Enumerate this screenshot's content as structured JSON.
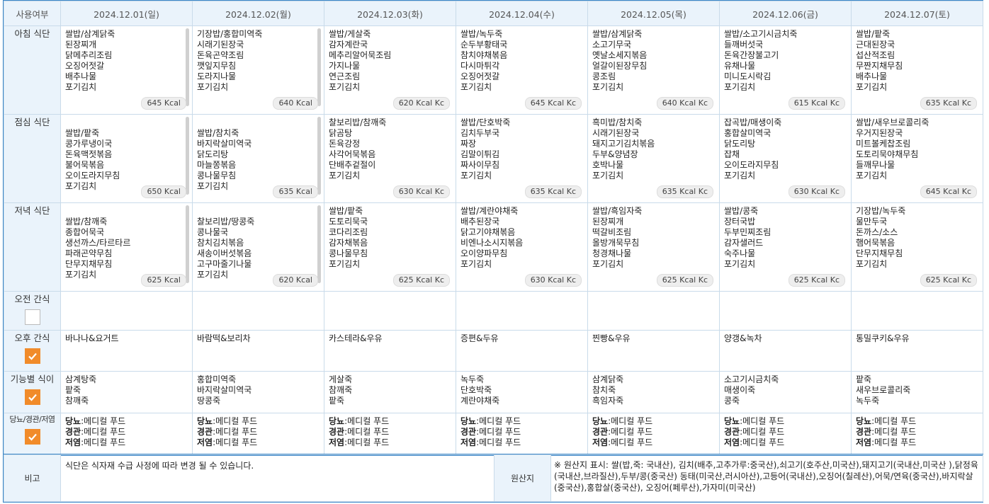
{
  "header": {
    "first_col": "사용여부",
    "dates": [
      {
        "label": "2024.12.01(일)",
        "kind": "sun"
      },
      {
        "label": "2024.12.02(월)",
        "kind": "normal"
      },
      {
        "label": "2024.12.03(화)",
        "kind": "normal"
      },
      {
        "label": "2024.12.04(수)",
        "kind": "normal"
      },
      {
        "label": "2024.12.05(목)",
        "kind": "normal"
      },
      {
        "label": "2024.12.06(금)",
        "kind": "normal"
      },
      {
        "label": "2024.12.07(토)",
        "kind": "sat"
      }
    ]
  },
  "rows": {
    "breakfast": {
      "label": "아침 식단",
      "days": [
        {
          "items": [
            "쌀밥/삼계닭죽",
            "된장찌개",
            "닭메추리조림",
            "오징어젓갈",
            "배추나물",
            "포기김치"
          ],
          "kcal": "645 Kcal",
          "scroll": true
        },
        {
          "items": [
            "기장밥/홍합미역죽",
            "시래기된장국",
            "돈육곤약조림",
            "깻잎지무침",
            "도라지나물",
            "포기김치"
          ],
          "kcal": "640 Kcal",
          "scroll": true
        },
        {
          "items": [
            "쌀밥/게살죽",
            "감자계란국",
            "메추리알어묵조림",
            "가지나물",
            "연근조림",
            "포기김치"
          ],
          "kcal": "620 Kcal Kc",
          "scroll": false
        },
        {
          "items": [
            "쌀밥/녹두죽",
            "순두부황태국",
            "참치야채볶음",
            "다시마튀각",
            "오징어젓갈",
            "포기김치"
          ],
          "kcal": "645 Kcal Kc",
          "scroll": false
        },
        {
          "items": [
            "쌀밥/삼계닭죽",
            "소고기무국",
            "옛날소세지볶음",
            "얼갈이된장무침",
            "콩조림",
            "포기김치"
          ],
          "kcal": "640 Kcal Kc",
          "scroll": false
        },
        {
          "items": [
            "쌀밥/소고기시금치죽",
            "들깨버섯국",
            "돈육간장불고기",
            "유채나물",
            "미니도시락김",
            "포기김치"
          ],
          "kcal": "615 Kcal Kc",
          "scroll": false
        },
        {
          "items": [
            "쌀밥/팥죽",
            "근대된장국",
            "섭산적조림",
            "무짠지채무침",
            "배추나물",
            "포기김치"
          ],
          "kcal": "635 Kcal Kc",
          "scroll": false
        }
      ]
    },
    "lunch": {
      "label": "점심 식단",
      "days": [
        {
          "items": [
            "",
            "쌀밥/팥죽",
            "콩가루냉이국",
            "돈육맥젓볶음",
            "불어묵볶음",
            "오이도라지무침",
            "포기김치"
          ],
          "kcal": "650 Kcal",
          "scroll": true
        },
        {
          "items": [
            "",
            "쌀밥/참치죽",
            "바지락살미역국",
            "닭도리탕",
            "마늘쫑볶음",
            "콩나물무침",
            "포기김치"
          ],
          "kcal": "635 Kcal",
          "scroll": true
        },
        {
          "items": [
            "찰보리밥/참깨죽",
            "닭곰탕",
            "돈육강정",
            "사각어묵볶음",
            "단배추겉절이",
            "포기김치"
          ],
          "kcal": "630 Kcal Kc",
          "scroll": false
        },
        {
          "items": [
            "쌀밥/단호박죽",
            "김치두부국",
            "짜장",
            "김말이튀김",
            "짜사이무침",
            "포기김치"
          ],
          "kcal": "635 Kcal Kc",
          "scroll": false
        },
        {
          "items": [
            "흑미밥/참치죽",
            "시래기된장국",
            "돼지고기김치볶음",
            "두부&양념장",
            "호박나물",
            "포기김치"
          ],
          "kcal": "635 Kcal Kc",
          "scroll": false
        },
        {
          "items": [
            "잡곡밥/매생이죽",
            "홍합살미역국",
            "닭도리탕",
            "잡채",
            "오이도라지무침",
            "포기김치"
          ],
          "kcal": "630 Kcal Kc",
          "scroll": false
        },
        {
          "items": [
            "쌀밥/새우브로콜리죽",
            "우거지된장국",
            "미트볼케찹조림",
            "도토리묵야채무침",
            "들깨무나물",
            "포기김치"
          ],
          "kcal": "645 Kcal Kc",
          "scroll": false
        }
      ]
    },
    "dinner": {
      "label": "저녁 식단",
      "days": [
        {
          "items": [
            "",
            "쌀밥/참깨죽",
            "종합어묵국",
            "생선까스/타르타르",
            "파래곤약무침",
            "단무지채무침",
            "포기김치"
          ],
          "kcal": "625 Kcal",
          "scroll": true
        },
        {
          "items": [
            "",
            "찰보리밥/땅콩죽",
            "콩나물국",
            "참치김치볶음",
            "새송이버섯볶음",
            "고구마줄기나물",
            "포기김치"
          ],
          "kcal": "620 Kcal",
          "scroll": true
        },
        {
          "items": [
            "쌀밥/팥죽",
            "도토리묵국",
            "코다리조림",
            "감자채볶음",
            "콩나물무침",
            "포기김치"
          ],
          "kcal": "625 Kcal Kc",
          "scroll": false
        },
        {
          "items": [
            "쌀밥/계란야채죽",
            "배추된장국",
            "닭고기야채볶음",
            "비엔나소시지볶음",
            "오이양파무침",
            "포기김치"
          ],
          "kcal": "630 Kcal Kc",
          "scroll": false
        },
        {
          "items": [
            "쌀밥/흑임자죽",
            "된장찌개",
            "떡갈비조림",
            "올방개묵무침",
            "청경채나물",
            "포기김치"
          ],
          "kcal": "625 Kcal Kc",
          "scroll": false
        },
        {
          "items": [
            "쌀밥/콩죽",
            "장터국밥",
            "두부민찌조림",
            "감자샐러드",
            "숙주나물",
            "포기김치"
          ],
          "kcal": "625 Kcal Kc",
          "scroll": false
        },
        {
          "items": [
            "기장밥/녹두죽",
            "물만두국",
            "돈까스/소스",
            "햄어묵볶음",
            "단무지채무침",
            "포기김치"
          ],
          "kcal": "625 Kcal Kc",
          "scroll": false
        }
      ]
    },
    "am_snack": {
      "label": "오전 간식",
      "checked": false,
      "days": [
        "",
        "",
        "",
        "",
        "",
        "",
        ""
      ]
    },
    "pm_snack": {
      "label": "오후 간식",
      "checked": true,
      "days": [
        "바나나&요거트",
        "바람떡&보리차",
        "카스테라&우유",
        "증편&두유",
        "찐빵&우유",
        "양갱&녹차",
        "통밀쿠키&우유"
      ]
    },
    "functional": {
      "label": "기능별 식이",
      "checked": true,
      "days": [
        [
          "삼계탕죽",
          "팥죽",
          "참깨죽"
        ],
        [
          "홍합미역죽",
          "바지락살미역국",
          "땅콩죽"
        ],
        [
          "게살죽",
          "참깨죽",
          "팥죽"
        ],
        [
          "녹두죽",
          "단호박죽",
          "계란야채죽"
        ],
        [
          "삼계닭죽",
          "참치죽",
          "흑임자죽"
        ],
        [
          "소고기시금치죽",
          "매생이죽",
          "콩죽"
        ],
        [
          "팥죽",
          "새우브로콜리죽",
          "녹두죽"
        ]
      ]
    },
    "medical": {
      "label": "당뇨/경관/저염",
      "checked": true,
      "lines": [
        {
          "k": "당뇨",
          "v": ":메디컬 푸드"
        },
        {
          "k": "경관",
          "v": ":메디컬 푸드"
        },
        {
          "k": "저염",
          "v": ":메디컬 푸드"
        }
      ]
    }
  },
  "footer": {
    "note_label": "비고",
    "note_text": "식단은 식자재 수급 사정에 따라 변경 될 수 있습니다.",
    "origin_label": "원산지",
    "origin_text": "※ 원산지 표시: 쌀(밥,죽: 국내산), 김치(배추,고추가루:중국산),쇠고기(호주산,미국산),돼지고기(국내산,미국산 ),닭정육(국내산,브라질산),두부/콩(중국산) 동태(미국산,러시아산),고등어(국내산),오징어(칠레산),어묵/연육(중국산),바지락살(중국산),홍합살(중국산), 오징어(페루산),가자미(미국산)"
  },
  "colors": {
    "accent_border": "#3a86c8",
    "header_bg": "#eaf3fb",
    "checkbox_on": "#f18b2a",
    "sunday": "#d2232a",
    "saturday": "#1a44c8"
  }
}
